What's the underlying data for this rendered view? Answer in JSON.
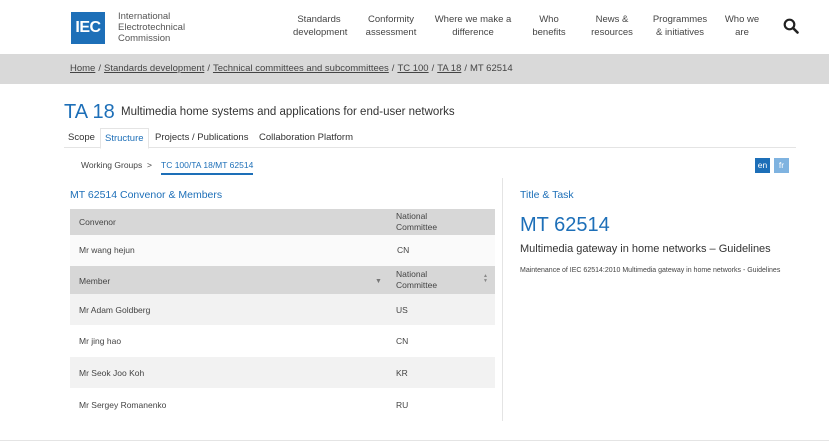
{
  "header": {
    "logo_text": "IEC",
    "org_line1": "International",
    "org_line2": "Electrotechnical",
    "org_line3": "Commission",
    "nav": [
      {
        "line1": "Standards",
        "line2": "development"
      },
      {
        "line1": "Conformity",
        "line2": "assessment"
      },
      {
        "line1": "Where we make a",
        "line2": "difference"
      },
      {
        "line1": "Who",
        "line2": "benefits"
      },
      {
        "line1": "News &",
        "line2": "resources"
      },
      {
        "line1": "Programmes",
        "line2": "& initiatives"
      },
      {
        "line1": "Who we",
        "line2": "are"
      }
    ],
    "search_icon": "search-icon"
  },
  "breadcrumb": {
    "items": [
      "Home",
      "Standards development",
      "Technical committees and subcommittees",
      "TC 100",
      "TA 18"
    ],
    "current": "MT 62514"
  },
  "page": {
    "code": "TA 18",
    "title": "Multimedia home systems and applications for end-user networks"
  },
  "tabs": [
    "Scope",
    "Structure",
    "Projects / Publications",
    "Collaboration Platform"
  ],
  "active_tab": "Structure",
  "subnav": {
    "link": "Working Groups",
    "arrow": ">",
    "active": "TC 100/TA 18/MT 62514"
  },
  "languages": {
    "en": "en",
    "fr": "fr"
  },
  "left_panel": {
    "title": "MT 62514 Convenor & Members",
    "convenor_header": {
      "col1": "Convenor",
      "col2_line1": "National",
      "col2_line2": "Committee"
    },
    "convenor": {
      "name": "Mr wang hejun",
      "nc": "CN"
    },
    "member_header": {
      "col1": "Member",
      "col2_line1": "National",
      "col2_line2": "Committee"
    },
    "members": [
      {
        "name": "Mr Adam Goldberg",
        "nc": "US"
      },
      {
        "name": "Mr jing hao",
        "nc": "CN"
      },
      {
        "name": "Mr Seok Joo Koh",
        "nc": "KR"
      },
      {
        "name": "Mr Sergey Romanenko",
        "nc": "RU"
      }
    ]
  },
  "right_panel": {
    "title": "Title & Task",
    "code": "MT 62514",
    "subtitle": "Multimedia gateway in home networks – Guidelines",
    "description": "Maintenance of IEC 62514:2010 Multimedia gateway in home networks - Guidelines"
  },
  "colors": {
    "brand": "#1d6fb8",
    "band": "#d9d9d9",
    "table_header": "#d7d7d7"
  }
}
